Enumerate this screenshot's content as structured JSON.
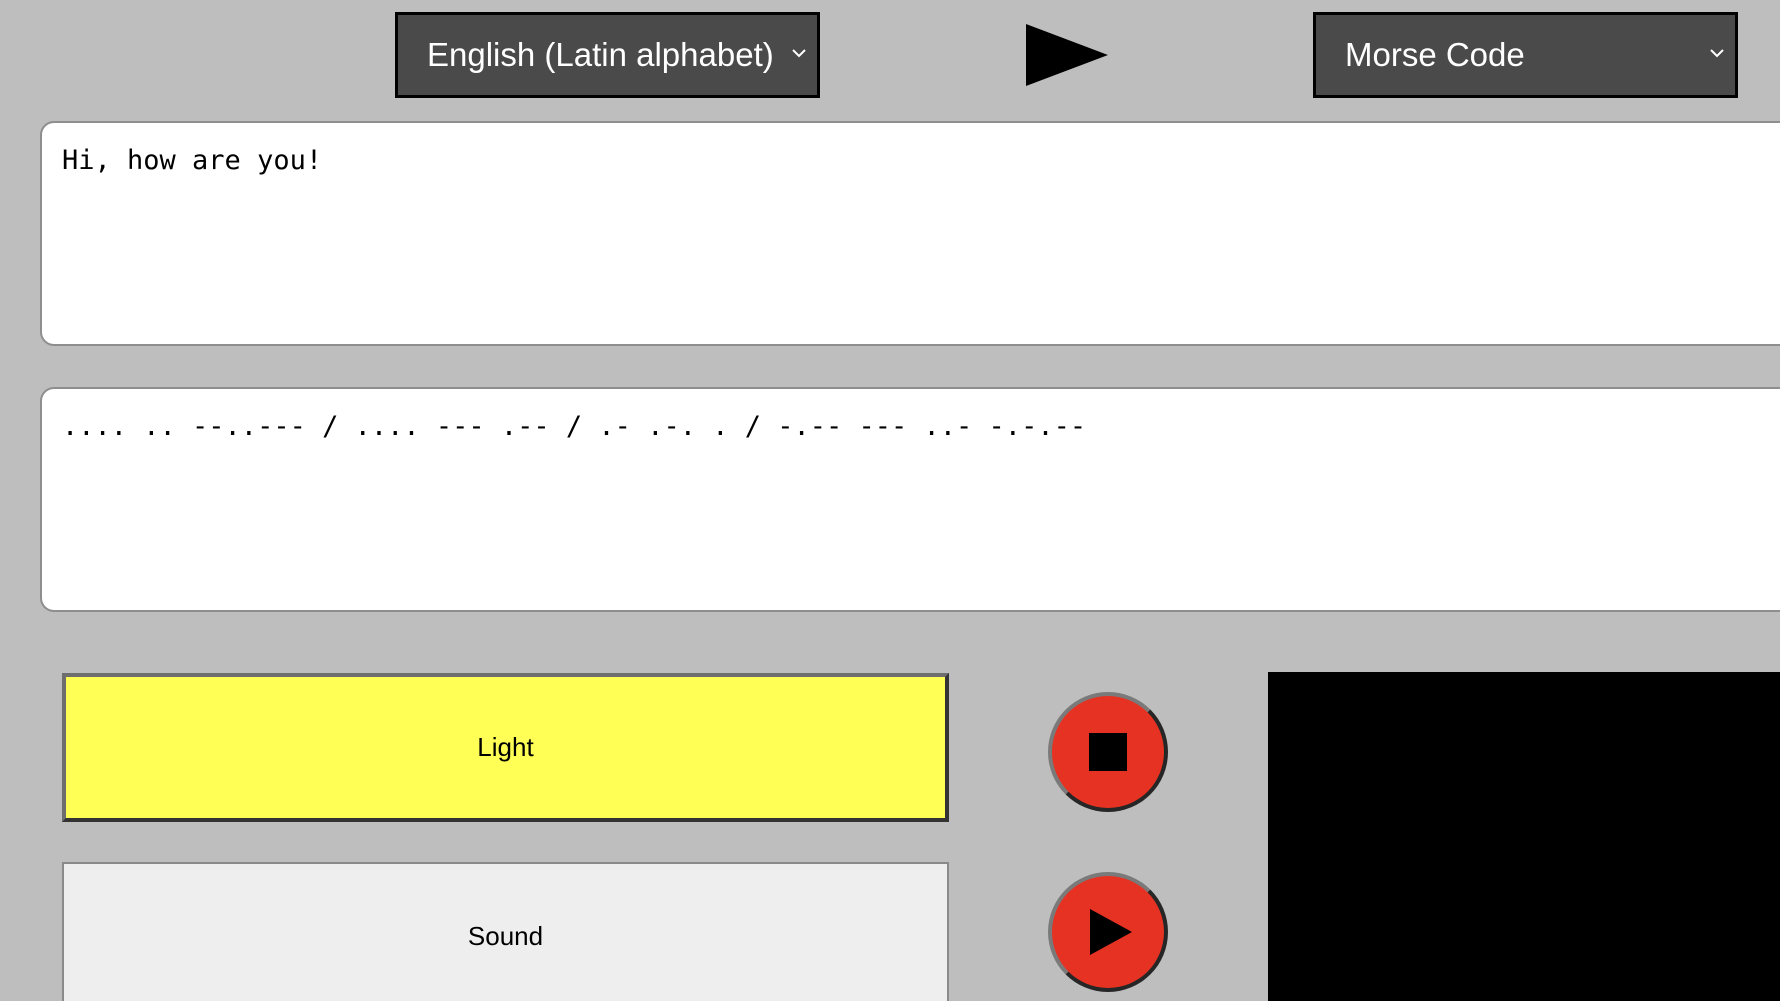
{
  "source_language": {
    "selected": "English (Latin alphabet)"
  },
  "target_language": {
    "selected": "Morse Code"
  },
  "input_text": "Hi, how are you!",
  "output_text": ".... .. --..--- / .... --- .-- / .- .-. . / -.-- --- ..- -.-.--",
  "buttons": {
    "light_label": "Light",
    "sound_label": "Sound"
  },
  "icons": {
    "direction": "play-triangle-icon",
    "stop": "stop-icon",
    "play": "play-icon",
    "dropdown": "chevron-down-icon"
  },
  "colors": {
    "background": "#bebebe",
    "select_bg": "#4a4a4a",
    "light_active": "#ffff55",
    "round_button": "#e53222",
    "light_panel": "#000000"
  }
}
